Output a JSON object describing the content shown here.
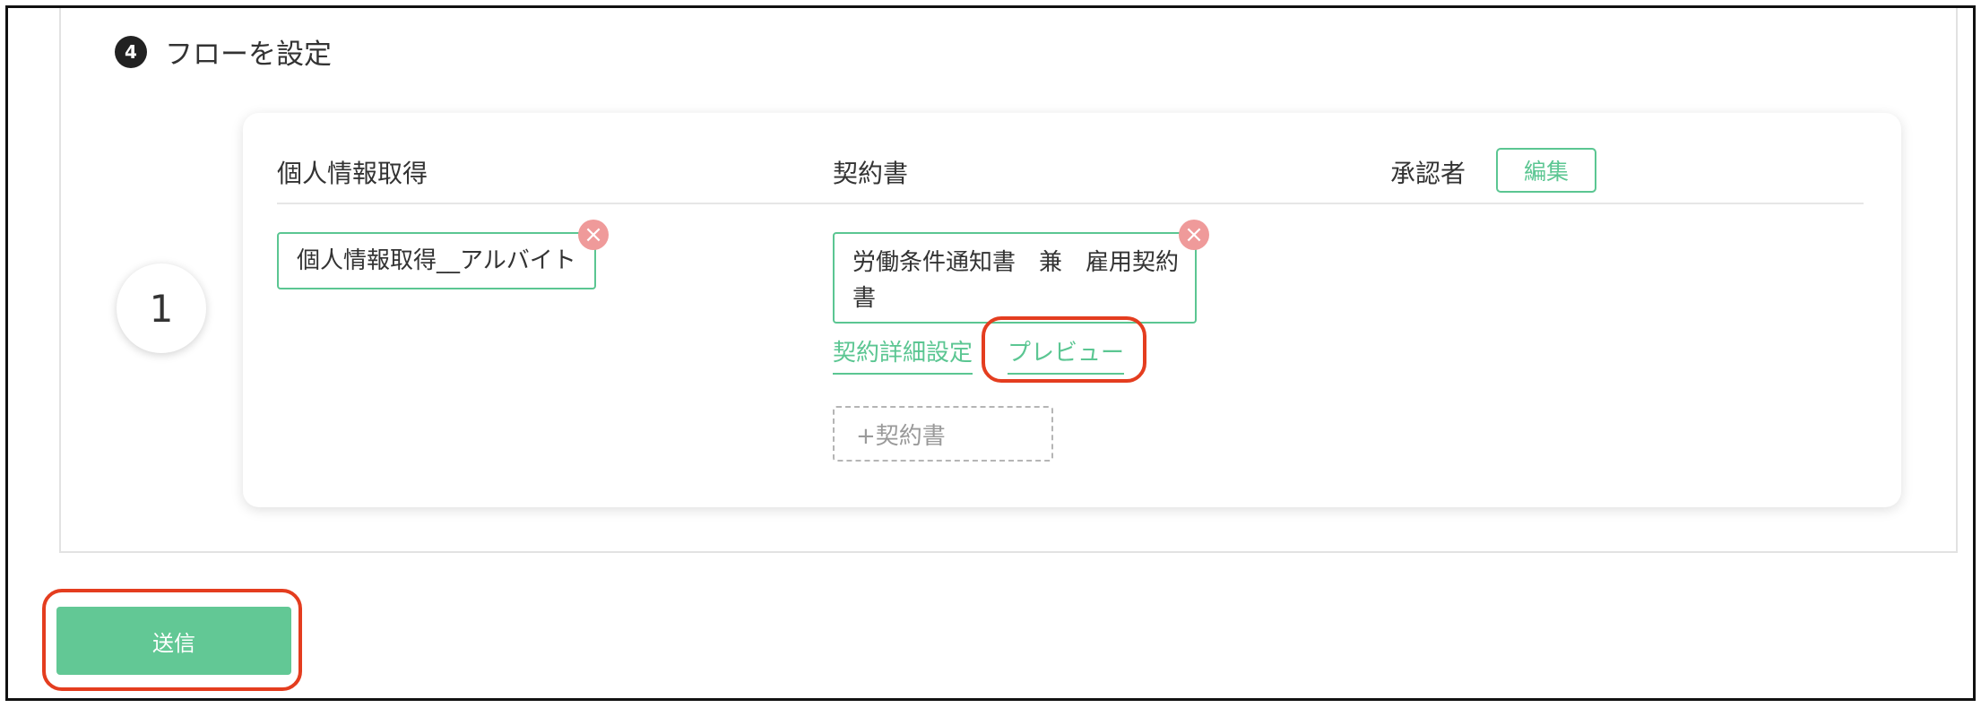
{
  "section": {
    "step_number": "4",
    "title": "フローを設定"
  },
  "flow": {
    "step_index": "1",
    "columns": {
      "personal_info": "個人情報取得",
      "contract": "契約書",
      "approver": "承認者"
    },
    "edit_label": "編集",
    "personal_info_item": "個人情報取得__アルバイト",
    "contract_item": "労働条件通知書　兼　雇用契約書",
    "contract_detail_link": "契約詳細設定",
    "preview_link": "プレビュー",
    "add_contract_label": "+契約書",
    "remove_icon": "×"
  },
  "submit_label": "送信",
  "colors": {
    "accent": "#5bc692",
    "submit_bg": "#62c895",
    "remove": "#ef9a9a",
    "annotation": "#e43d1f"
  }
}
